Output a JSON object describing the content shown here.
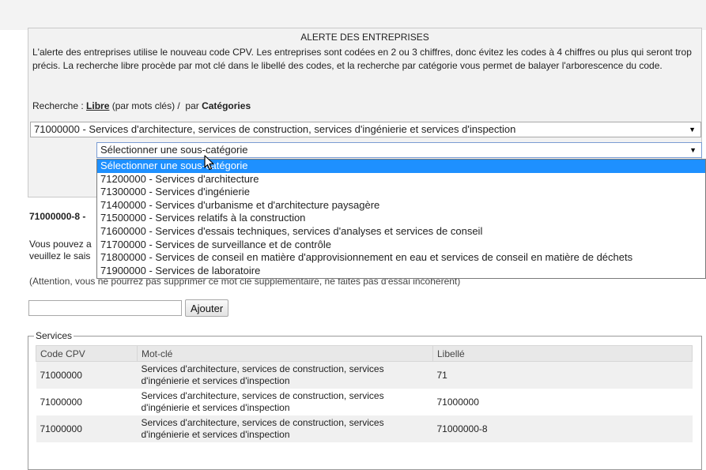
{
  "alert": {
    "title": "ALERTE DES ENTREPRISES",
    "description": "L'alerte des entreprises utilise le nouveau code CPV. Les entreprises sont codées en 2 ou 3 chiffres, donc évitez les codes à 4 chiffres ou plus qui seront trop précis. La recherche libre procède par mot clé dans le libellé des codes, et la recherche par catégorie vous permet de balayer l'arborescence du code.",
    "recherche_label": "Recherche : ",
    "libre_link": "Libre",
    "libre_suffix": " (par mots clés) /  par ",
    "categories_link": "Catégories"
  },
  "category_select": {
    "value": "71000000 - Services d'architecture, services de construction, services d'ingénierie et services d'inspection"
  },
  "subcategory_select": {
    "value": "Sélectionner une sous-catégorie",
    "options": [
      "Sélectionner une sous-catégorie",
      "71200000 - Services d'architecture",
      "71300000 - Services d'ingénierie",
      "71400000 - Services d'urbanisme et d'architecture paysagère",
      "71500000 - Services relatifs à la construction",
      "71600000 - Services d'essais techniques, services d'analyses et services de conseil",
      "71700000 - Services de surveillance et de contrôle",
      "71800000 - Services de conseil en matière d'approvisionnement en eau et services de conseil en matière de déchets",
      "71900000 - Services de laboratoire"
    ]
  },
  "behind": {
    "code_heading": "71000000-8 -",
    "para1_line1": "Vous pouvez a",
    "para1_line2": "veuillez le sais",
    "para2": "(Attention, vous ne pourrez pas supprimer ce mot clé supplémentaire, ne faites pas d'essai incohérent)"
  },
  "add_form": {
    "input_value": "",
    "button_label": "Ajouter"
  },
  "services": {
    "legend": "Services",
    "headers": [
      "Code CPV",
      "Mot-clé",
      "Libellé"
    ],
    "rows": [
      {
        "code": "71000000",
        "motcle": "Services d'architecture, services de construction, services d'ingénierie et services d'inspection",
        "libelle": "71"
      },
      {
        "code": "71000000",
        "motcle": "Services d'architecture, services de construction, services d'ingénierie et services d'inspection",
        "libelle": "71000000"
      },
      {
        "code": "71000000",
        "motcle": "Services d'architecture, services de construction, services d'ingénierie et services d'inspection",
        "libelle": "71000000-8"
      }
    ]
  },
  "icons": {
    "select_arrow": "triangle-down-icon",
    "mouse_cursor": "pointer-arrow-icon"
  },
  "colors": {
    "selected_option_bg": "#1e90ff",
    "panel_bg": "#f2f2f2"
  }
}
